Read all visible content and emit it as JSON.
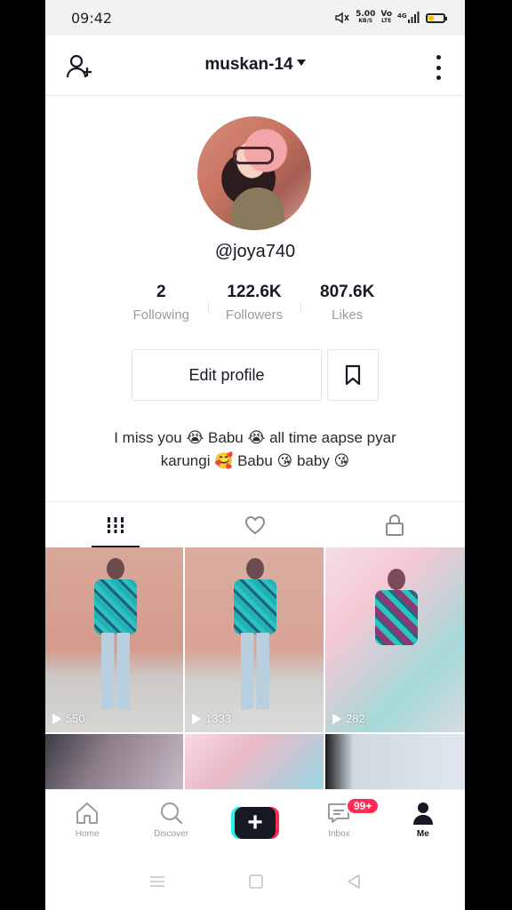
{
  "status_bar": {
    "time": "09:42",
    "net_speed": "5.00",
    "net_unit": "KB/S",
    "volte": "Vo",
    "volte_sub": "LTE",
    "network_type": "4G",
    "battery_color": "#f3c200"
  },
  "header": {
    "username": "muskan-14",
    "add_user_icon": "add-user-icon",
    "more_icon": "more-vertical-icon"
  },
  "profile": {
    "handle": "@joya740",
    "stats": [
      {
        "value": "2",
        "label": "Following"
      },
      {
        "value": "122.6K",
        "label": "Followers"
      },
      {
        "value": "807.6K",
        "label": "Likes"
      }
    ],
    "edit_profile_label": "Edit profile",
    "bio_line1": "I miss you 😭 Babu 😭 all time aapse pyar",
    "bio_line2": "karungi 🥰 Babu 😘 baby 😘"
  },
  "tabs": [
    {
      "icon": "grid-icon",
      "active": true
    },
    {
      "icon": "heart-icon",
      "active": false
    },
    {
      "icon": "lock-icon",
      "active": false
    }
  ],
  "videos": [
    {
      "views": "550"
    },
    {
      "views": "1333"
    },
    {
      "views": "282"
    },
    {
      "views": ""
    },
    {
      "views": ""
    },
    {
      "views": ""
    }
  ],
  "bottom_nav": {
    "home": "Home",
    "discover": "Discover",
    "create": "+",
    "inbox": "Inbox",
    "inbox_badge": "99+",
    "me": "Me"
  },
  "colors": {
    "accent_red": "#fe2c55",
    "accent_cyan": "#25f4ee",
    "text_primary": "#161823",
    "text_secondary": "#9a9ba0"
  }
}
